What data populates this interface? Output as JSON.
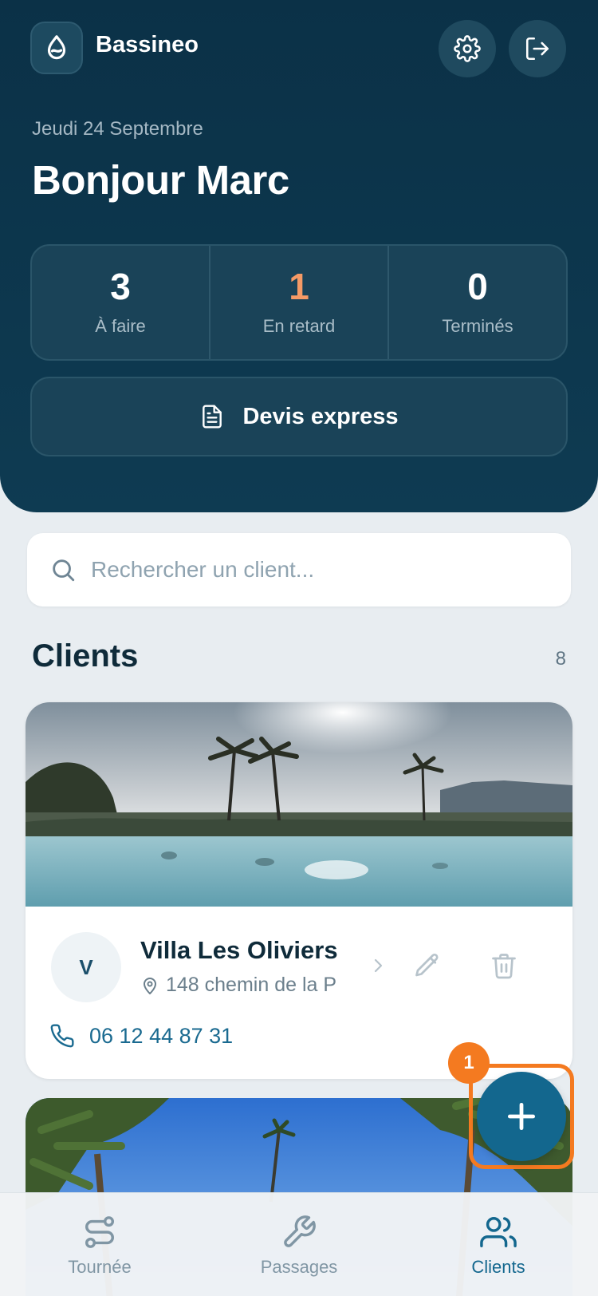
{
  "app": {
    "name": "Bassineo"
  },
  "header": {
    "date": "Jeudi 24 Septembre",
    "greeting": "Bonjour Marc",
    "stats": [
      {
        "value": "3",
        "label": "À faire"
      },
      {
        "value": "1",
        "label": "En retard"
      },
      {
        "value": "0",
        "label": "Terminés"
      }
    ],
    "devis_label": "Devis express"
  },
  "search": {
    "placeholder": "Rechercher un client..."
  },
  "clients": {
    "title": "Clients",
    "count": "8",
    "items": [
      {
        "initial": "V",
        "name": "Villa Les Oliviers",
        "address": "148 chemin de la P",
        "phone": "06 12 44 87 31"
      }
    ]
  },
  "fab": {
    "badge": "1",
    "icon": "plus-icon"
  },
  "nav": {
    "items": [
      {
        "label": "Tournée",
        "icon": "route-icon"
      },
      {
        "label": "Passages",
        "icon": "wrench-icon"
      },
      {
        "label": "Clients",
        "icon": "users-icon",
        "active": true
      }
    ]
  },
  "colors": {
    "header_bg": "#0b3147",
    "accent": "#13678e",
    "late": "#f59a66",
    "highlight": "#f47a20"
  }
}
